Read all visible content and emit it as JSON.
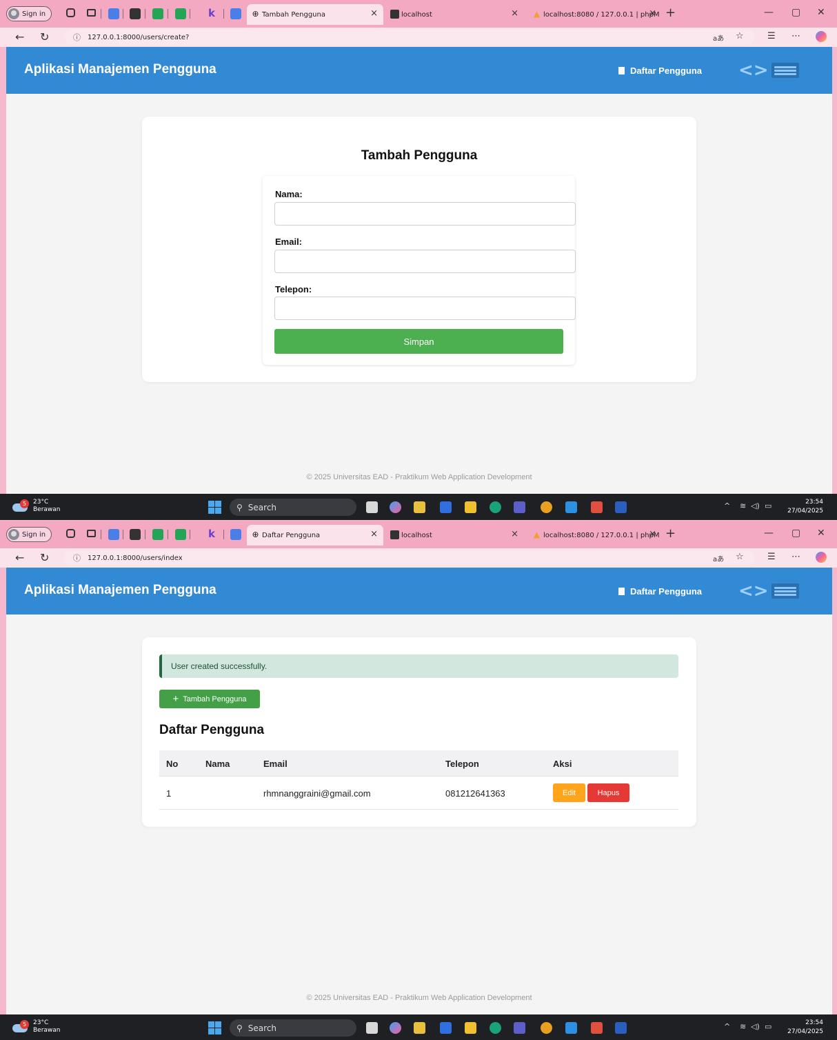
{
  "browser": {
    "sign_in": "Sign in",
    "tabs": [
      "Tambah Pengguna",
      "localhost",
      "localhost:8080 / 127.0.0.1 | phpM"
    ],
    "tabs_s2": [
      "Daftar Pengguna",
      "localhost",
      "localhost:8080 / 127.0.0.1 | phpM"
    ],
    "url1": "127.0.0.1:8000/users/create?",
    "url2": "127.0.0.1:8000/users/index"
  },
  "app": {
    "title": "Aplikasi Manajemen Pengguna",
    "nav_link": "Daftar Pengguna",
    "footer": "© 2025 Universitas EAD - Praktikum Web Application Development"
  },
  "form": {
    "title": "Tambah Pengguna",
    "name_label": "Nama:",
    "email_label": "Email:",
    "phone_label": "Telepon:",
    "name_value": "",
    "email_value": "",
    "phone_value": "",
    "submit": "Simpan"
  },
  "list": {
    "alert": "User created successfully.",
    "add_button": "Tambah Pengguna",
    "title": "Daftar Pengguna",
    "headers": [
      "No",
      "Nama",
      "Email",
      "Telepon",
      "Aksi"
    ],
    "rows": [
      {
        "no": "1",
        "nama": "",
        "email": "rhmnanggraini@gmail.com",
        "telepon": "081212641363"
      }
    ],
    "edit": "Edit",
    "delete": "Hapus"
  },
  "taskbar": {
    "temp": "23°C",
    "condition": "Berawan",
    "weather_badge": "5",
    "search": "Search",
    "time": "23:54",
    "date": "27/04/2025"
  },
  "colors": {
    "app_bar": "#338ad4",
    "submit_green": "#4caf50",
    "edit_orange": "#ffa41b",
    "delete_red": "#e53935",
    "alert_bg": "#d2e7dd"
  },
  "icons": [
    "user-avatar-icon",
    "globe-icon",
    "close-icon",
    "plus-icon",
    "back-arrow-icon",
    "reload-icon",
    "info-icon",
    "star-icon",
    "document-icon",
    "windows-logo-icon",
    "search-icon"
  ]
}
